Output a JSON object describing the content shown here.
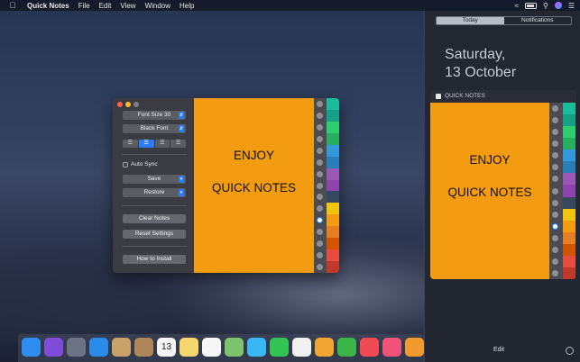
{
  "menubar": {
    "apple": "",
    "app_name": "Quick Notes",
    "menus": [
      "File",
      "Edit",
      "View",
      "Window",
      "Help"
    ]
  },
  "window": {
    "font_size": "Font Size 30",
    "font_color": "Black Font",
    "alignment_options": [
      "left",
      "center",
      "right",
      "justify"
    ],
    "selected_alignment": "center",
    "auto_sync": {
      "label": "Auto Sync",
      "checked": false
    },
    "save": "Save",
    "restore": "Restore",
    "clear_notes": "Clear Notes",
    "reset_settings": "Reset Settings",
    "how_to_install": "How to Install",
    "note": {
      "line1": "ENJOY",
      "line2": "QUICK NOTES",
      "color": "#f39c12"
    },
    "selected_ring": 10,
    "ring_count": 15
  },
  "tab_colors": [
    "#1abc9c",
    "#16a085",
    "#2ecc71",
    "#27ae60",
    "#3498db",
    "#2980b9",
    "#9b59b6",
    "#8e44ad",
    "#34495e",
    "#f1c40f",
    "#f39c12",
    "#e67e22",
    "#d35400",
    "#e74c3c",
    "#c0392b"
  ],
  "notification_center": {
    "tabs": [
      "Today",
      "Notifications"
    ],
    "active_tab": "Today",
    "date_day": "Saturday,",
    "date_full": "13 October",
    "widget_title": "QUICK NOTES",
    "note": {
      "line1": "ENJOY",
      "line2": "QUICK NOTES"
    },
    "edit": "Edit"
  },
  "dock": {
    "apps": [
      {
        "name": "finder",
        "color": "#2f8cf0"
      },
      {
        "name": "siri",
        "color": "#7f4bd8"
      },
      {
        "name": "launchpad",
        "color": "#6b7384"
      },
      {
        "name": "safari",
        "color": "#2a8be8"
      },
      {
        "name": "mail-stamp",
        "color": "#c9a26a"
      },
      {
        "name": "contacts",
        "color": "#b0875b"
      },
      {
        "name": "calendar",
        "color": "#f4f4f4",
        "text": "13"
      },
      {
        "name": "notes",
        "color": "#f5d76e"
      },
      {
        "name": "reminders",
        "color": "#f6f6f6"
      },
      {
        "name": "maps",
        "color": "#7cc36b"
      },
      {
        "name": "messages",
        "color": "#3ab7f5"
      },
      {
        "name": "facetime",
        "color": "#33c454"
      },
      {
        "name": "photos",
        "color": "#f0f0f0"
      },
      {
        "name": "pages",
        "color": "#f3a534"
      },
      {
        "name": "numbers",
        "color": "#3bb44a"
      },
      {
        "name": "news",
        "color": "#f04a55"
      },
      {
        "name": "itunes",
        "color": "#f0537a"
      },
      {
        "name": "books",
        "color": "#f29a2e"
      }
    ]
  }
}
